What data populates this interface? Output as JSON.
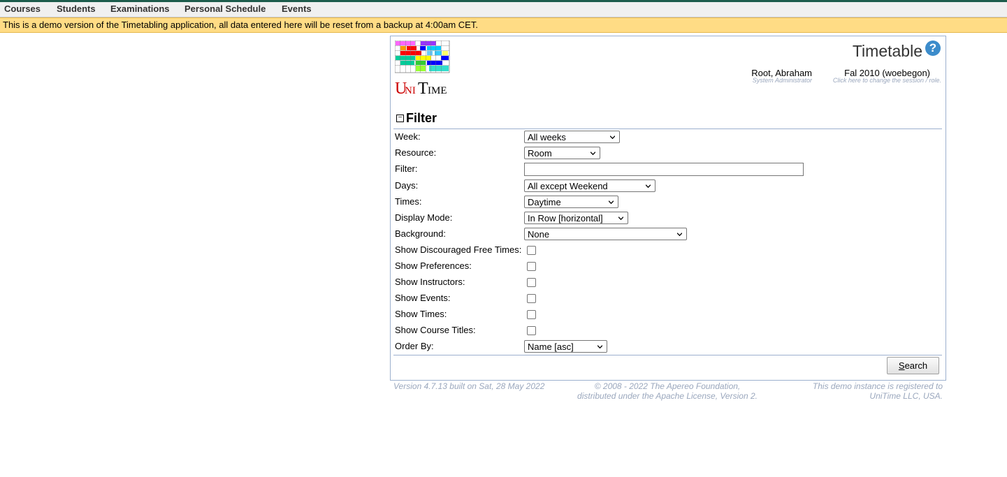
{
  "menu": {
    "items": [
      "Courses",
      "Students",
      "Examinations",
      "Personal Schedule",
      "Events"
    ]
  },
  "banner": {
    "text": "This is a demo version of the Timetabling application, all data entered here will be reset from a backup at 4:00am CET."
  },
  "header": {
    "logo_text": "UniTime",
    "title": "Timetable",
    "help_icon": "question-circle-icon",
    "user_name": "Root, Abraham",
    "user_role": "System Administrator",
    "session": "Fal 2010 (woebegon)",
    "session_hint": "Click here to change the session / role."
  },
  "filter": {
    "title": "Filter",
    "week_label": "Week:",
    "week_value": "All weeks",
    "resource_label": "Resource:",
    "resource_value": "Room",
    "filter_label": "Filter:",
    "filter_value": "",
    "days_label": "Days:",
    "days_value": "All except Weekend",
    "times_label": "Times:",
    "times_value": "Daytime",
    "display_mode_label": "Display Mode:",
    "display_mode_value": "In Row [horizontal]",
    "background_label": "Background:",
    "background_value": "None",
    "show_discouraged_label": "Show Discouraged Free Times:",
    "show_preferences_label": "Show Preferences:",
    "show_instructors_label": "Show Instructors:",
    "show_events_label": "Show Events:",
    "show_times_label": "Show Times:",
    "show_course_titles_label": "Show Course Titles:",
    "order_by_label": "Order By:",
    "order_by_value": "Name [asc]",
    "search_prefix": "S",
    "search_rest": "earch"
  },
  "footer": {
    "version": "Version 4.7.13 built on Sat, 28 May 2022",
    "copyright_line1": "© 2008 - 2022 The Apereo Foundation,",
    "copyright_line2": "distributed under the Apache License, Version 2.",
    "registered_line1": "This demo instance is registered to",
    "registered_line2": "UniTime LLC, USA."
  },
  "colors": {
    "banner_bg": "#ffdc85",
    "panel_border": "#9cb0ce",
    "help_blue": "#3c8ccb",
    "footer_text": "#9aa7bd"
  }
}
